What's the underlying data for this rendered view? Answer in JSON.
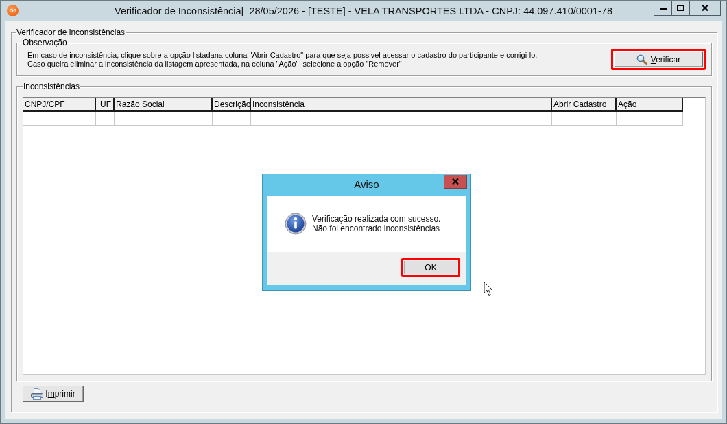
{
  "window": {
    "logo_text": "G5",
    "title": "Verificador de Inconsistência|  28/05/2026 - [TESTE] - VELA TRANSPORTES LTDA - CNPJ: 44.097.410/0001-78",
    "controls": [
      {
        "kind": "minimize"
      },
      {
        "kind": "maximize"
      },
      {
        "kind": "close"
      }
    ]
  },
  "main_group": {
    "title": "Verificador de inconsistências",
    "observation": {
      "title": "Observação",
      "lines": [
        "Em caso de inconsistência, clique sobre a opção listadana coluna \"Abrir Cadastro\" para que seja possivel acessar o cadastro do participante e corrigi-lo.",
        "Caso queira eliminar a inconsistência da listagem apresentada, na coluna \"Ação\"  selecione a opção \"Remover\""
      ],
      "button": {
        "access_key": "V",
        "text_after_key": "erificar",
        "highlighted": true
      }
    },
    "inconsistencies": {
      "title": "Inconsistências",
      "table": {
        "columns": [
          {
            "label": "CNPJ/CPF"
          },
          {
            "label": "UF"
          },
          {
            "label": "Razão Social"
          },
          {
            "label": "Descrição"
          },
          {
            "label": "Inconsistência"
          },
          {
            "label": "Abrir Cadastro"
          },
          {
            "label": "Ação"
          }
        ]
      }
    },
    "print_button": {
      "text_before_key": "I",
      "access_key": "m",
      "text_after_key": "primir"
    }
  },
  "dialog": {
    "title": "Aviso",
    "message_lines": [
      "Verificação realizada com sucesso.",
      "Não foi encontrado inconsistências"
    ],
    "buttons": [
      {
        "label": "OK",
        "highlighted": true
      }
    ]
  }
}
